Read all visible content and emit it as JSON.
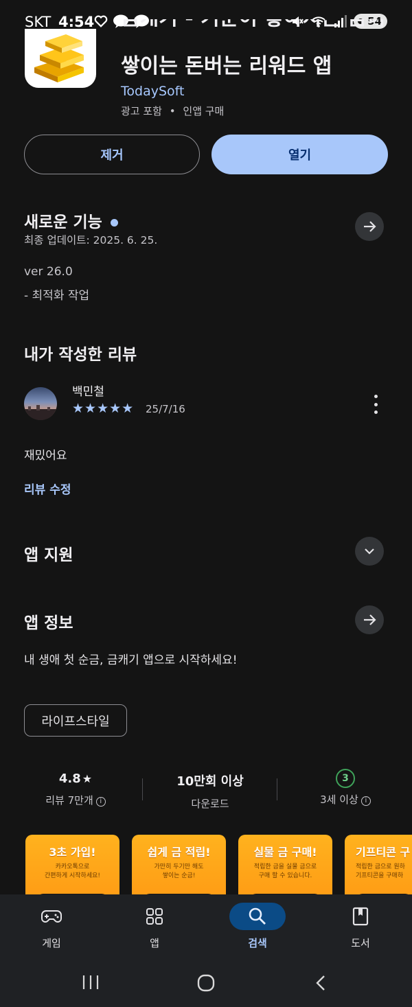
{
  "status_bar": {
    "carrier": "SKT",
    "time": "4:54",
    "battery": "54"
  },
  "app": {
    "title_line1": "금캐기 - 기분이 좋아지는 금이",
    "title_line2": "쌓이는 돈버는 리워드 앱",
    "developer": "TodaySoft",
    "meta_ads": "광고 포함",
    "meta_sep": "•",
    "meta_iap": "인앱 구매"
  },
  "actions": {
    "remove_label": "제거",
    "open_label": "열기"
  },
  "whats_new": {
    "title": "새로운 기능",
    "updated": "최종 업데이트: 2025. 6. 25.",
    "version": "ver 26.0",
    "note": "- 최적화 작업"
  },
  "my_review": {
    "title": "내가 작성한 리뷰",
    "author": "백민철",
    "stars": "★★★★★",
    "rating": 5,
    "date": "25/7/16",
    "text": "재밌어요",
    "edit_label": "리뷰 수정"
  },
  "app_support": {
    "title": "앱 지원"
  },
  "app_info": {
    "title": "앱 정보",
    "description": "내 생애 첫 순금, 금캐기 앱으로 시작하세요!",
    "category": "라이프스타일"
  },
  "stats": {
    "rating_value": "4.8",
    "rating_star": "★",
    "reviews": "리뷰 7만개",
    "downloads_value": "10만회 이상",
    "downloads_label": "다운로드",
    "age_badge": "3",
    "age_label": "3세 이상"
  },
  "screenshots": [
    {
      "headline": "3초 가입!",
      "sub1": "카카오톡으로",
      "sub2": "간편하게 시작하세요!"
    },
    {
      "headline": "쉽게 금 적립!",
      "sub1": "가만히 두기만 해도",
      "sub2": "쌓이는 순금!"
    },
    {
      "headline": "실물 금 구매!",
      "sub1": "적립한 금을 실물 금으로",
      "sub2": "구매 할 수 있습니다."
    },
    {
      "headline": "기프티콘 구",
      "sub1": "적립한 금으로 원하",
      "sub2": "기프티콘을 구매하"
    }
  ],
  "bottom_nav": {
    "games": "게임",
    "apps": "앱",
    "search": "검색",
    "books": "도서",
    "active": "search"
  },
  "colors": {
    "background": "#141414",
    "accent": "#a8c7fa",
    "active_pill": "#0b4b86",
    "age_green": "#3fa35a"
  }
}
